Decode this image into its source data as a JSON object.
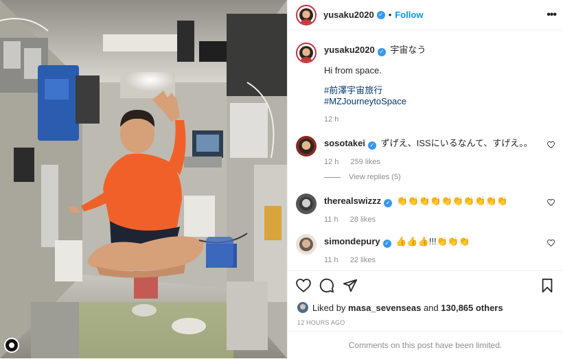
{
  "post": {
    "username": "yusaku2020",
    "follow_label": "Follow",
    "more_label": "•••",
    "separator": "•"
  },
  "caption": {
    "username": "yusaku2020",
    "title_text": "宇宙なう",
    "body": "Hi from space.",
    "hashtags": [
      "#前澤宇宙旅行",
      "#MZJourneytoSpace"
    ],
    "time": "12 h"
  },
  "comments": [
    {
      "username": "sosotakei",
      "text": "ずげえ、ISSにいるなんて、すげえ。。",
      "time": "12 h",
      "likes": "259 likes",
      "avatar_color": "#8a2a1f"
    },
    {
      "username": "therealswizzz",
      "text": "👏👏👏👏👏👏👏👏👏👏",
      "time": "11 h",
      "likes": "28 likes",
      "avatar_color": "#555555"
    },
    {
      "username": "simondepury",
      "text": "👍👍👍!!!👏👏👏",
      "time": "11 h",
      "likes": "22 likes",
      "avatar_color": "#c9b8a6"
    }
  ],
  "view_replies": "View replies (5)",
  "liked_by": {
    "prefix": "Liked by",
    "user": "masa_sevenseas",
    "middle": "and",
    "count": "130,865 others"
  },
  "timestamp": "12 HOURS AGO",
  "comments_limited": "Comments on this post have been limited.",
  "icons": [
    "heart-icon",
    "comment-icon",
    "share-icon",
    "bookmark-icon",
    "more-icon",
    "verified-icon"
  ],
  "colors": {
    "accent": "#0095f6",
    "verified": "#3897f0",
    "muted": "#8e8e8e",
    "text": "#262626"
  }
}
